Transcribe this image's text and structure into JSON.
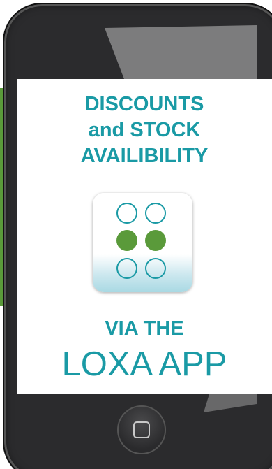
{
  "headline": {
    "line1": "DISCOUNTS",
    "line2": "and STOCK",
    "line3": "AVAILIBILITY"
  },
  "app_icon": {
    "name": "loxa-app-icon",
    "dots": [
      "outline",
      "outline",
      "filled",
      "filled",
      "outline",
      "outline"
    ]
  },
  "footer": {
    "via_the": "VIA THE",
    "brand": "LOXA APP"
  },
  "colors": {
    "teal": "#1a9aa5",
    "green": "#5a9a3a",
    "phone_body": "#2b2b2d"
  }
}
